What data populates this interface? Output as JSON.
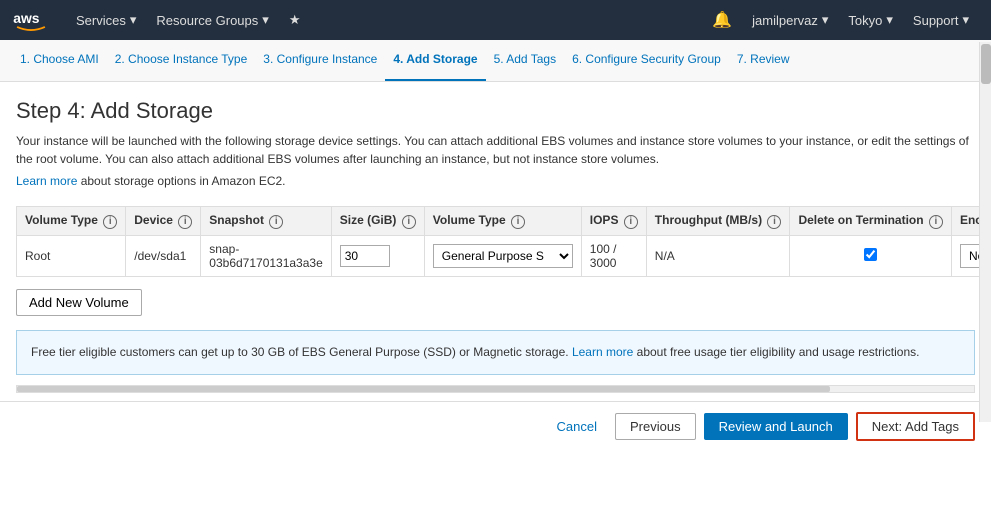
{
  "topnav": {
    "services_label": "Services",
    "resource_groups_label": "Resource Groups",
    "user_label": "jamilpervaz",
    "region_label": "Tokyo",
    "support_label": "Support"
  },
  "wizard": {
    "steps": [
      {
        "id": "choose-ami",
        "label": "1. Choose AMI",
        "active": false
      },
      {
        "id": "choose-instance-type",
        "label": "2. Choose Instance Type",
        "active": false
      },
      {
        "id": "configure-instance",
        "label": "3. Configure Instance",
        "active": false
      },
      {
        "id": "add-storage",
        "label": "4. Add Storage",
        "active": true
      },
      {
        "id": "add-tags",
        "label": "5. Add Tags",
        "active": false
      },
      {
        "id": "configure-security-group",
        "label": "6. Configure Security Group",
        "active": false
      },
      {
        "id": "review",
        "label": "7. Review",
        "active": false
      }
    ]
  },
  "page": {
    "title": "Step 4: Add Storage",
    "description": "Your instance will be launched with the following storage device settings. You can attach additional EBS volumes and instance store volumes to your instance, or edit the settings of the root volume. You can also attach additional EBS volumes after launching an instance, but not instance store volumes.",
    "learn_more_text": "Learn more",
    "learn_more_suffix": " about storage options in Amazon EC2."
  },
  "table": {
    "headers": {
      "volume_type": "Volume Type",
      "device": "Device",
      "snapshot": "Snapshot",
      "size_gib": "Size (GiB)",
      "volume_type_col": "Volume Type",
      "iops": "IOPS",
      "throughput": "Throughput (MB/s)",
      "delete_on_termination": "Delete on Termination",
      "encryption": "Encryption"
    },
    "rows": [
      {
        "volume_type": "Root",
        "device": "/dev/sda1",
        "snapshot": "snap-03b6d7170131a3a3e",
        "size": "30",
        "volume_type_val": "General Purpose S",
        "iops": "100 / 3000",
        "throughput": "N/A",
        "delete_checked": true,
        "encryption": "Not Encrypte"
      }
    ]
  },
  "buttons": {
    "add_volume": "Add New Volume",
    "cancel": "Cancel",
    "previous": "Previous",
    "review_launch": "Review and Launch",
    "next_add_tags": "Next: Add Tags"
  },
  "info_box": {
    "text": "Free tier eligible customers can get up to 30 GB of EBS General Purpose (SSD) or Magnetic storage.",
    "learn_more_text": "Learn more",
    "text_suffix": " about free usage tier eligibility and usage restrictions."
  }
}
